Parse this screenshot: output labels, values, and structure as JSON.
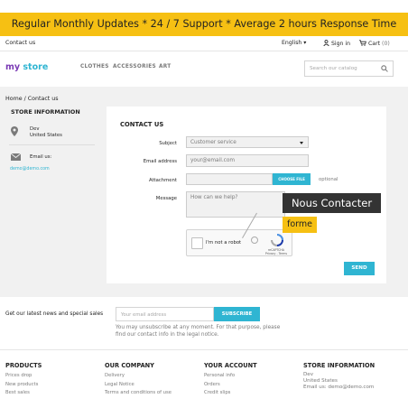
{
  "promo": {
    "text": "Regular Monthly Updates  *  24 / 7 Support  *  Average 2 hours Response Time"
  },
  "topbar": {
    "contact": "Contact us",
    "language": "English ▾",
    "signin": "Sign in",
    "cart_label": "Cart",
    "cart_count": "(0)"
  },
  "header": {
    "logo_my": "my",
    "logo_store": "store",
    "nav": [
      "CLOTHES",
      "ACCESSORIES",
      "ART"
    ],
    "search_placeholder": "Search our catalog"
  },
  "breadcrumb": {
    "home": "Home",
    "sep": "/",
    "current": "Contact us"
  },
  "sidebar": {
    "title": "STORE INFORMATION",
    "address_line1": "Dev",
    "address_line2": "United States",
    "email_label": "Email us:",
    "email": "demo@demo.com"
  },
  "form": {
    "title": "CONTACT US",
    "subject_label": "Subject",
    "subject_value": "Customer service",
    "email_label": "Email address",
    "email_placeholder": "your@email.com",
    "attachment_label": "Attachment",
    "choose_file": "CHOOSE FILE",
    "optional": "optional",
    "message_label": "Message",
    "message_placeholder": "How can we help?",
    "captcha_label": "I'm not a robot",
    "captcha_brand": "reCAPTCHA",
    "captcha_terms": "Privacy - Terms",
    "send": "SEND"
  },
  "overlay": {
    "title": "Nous Contacter",
    "subtitle": "forme"
  },
  "newsletter": {
    "text": "Get our latest news and special sales",
    "placeholder": "Your email address",
    "button": "SUBSCRIBE",
    "note": "You may unsubscribe at any moment. For that purpose, please find our contact info in the legal notice."
  },
  "footer": {
    "products": {
      "title": "PRODUCTS",
      "items": [
        "Prices drop",
        "New products",
        "Best sales"
      ]
    },
    "company": {
      "title": "OUR COMPANY",
      "items": [
        "Delivery",
        "Legal Notice",
        "Terms and conditions of use"
      ]
    },
    "account": {
      "title": "YOUR ACCOUNT",
      "items": [
        "Personal info",
        "Orders",
        "Credit slips"
      ]
    },
    "store": {
      "title": "STORE INFORMATION",
      "line1": "Dev",
      "line2": "United States",
      "email": "Email us: demo@demo.com"
    }
  },
  "colors": {
    "accent": "#2fb5d2",
    "promo": "#f6c013",
    "logo_my": "#7b3bb5"
  },
  "icons": [
    "user-icon",
    "cart-icon",
    "search-icon",
    "map-pin-icon",
    "envelope-icon",
    "recaptcha-icon",
    "chevron-down-icon"
  ]
}
